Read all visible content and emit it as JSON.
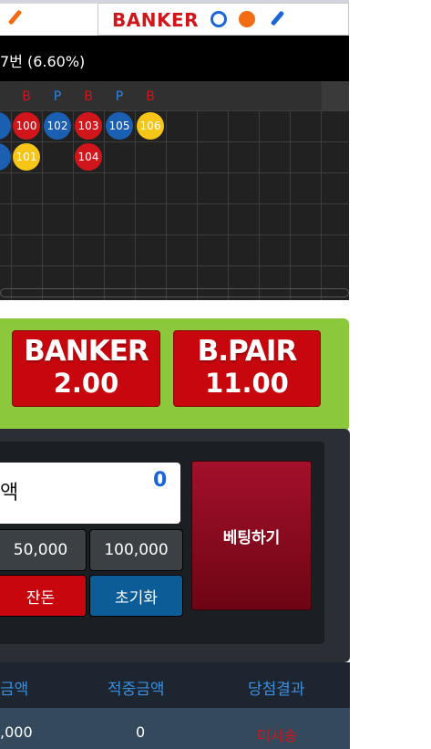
{
  "top": {
    "banker_title": "BANKER",
    "icons": [
      "pencil-icon",
      "ring-icon",
      "dot-icon",
      "pencil-icon"
    ],
    "colors": {
      "banker_red": "#d0161b",
      "player_blue": "#1b66d6",
      "orange": "#f36b12"
    }
  },
  "stats": {
    "text": "7번 (6.60%)"
  },
  "board": {
    "header_labels": [
      "B",
      "P",
      "B",
      "P",
      "B"
    ],
    "beads_row1": [
      {
        "label": "",
        "color": "#1b5fb3"
      },
      {
        "label": "100",
        "color": "#d0161b"
      },
      {
        "label": "102",
        "color": "#1b5fb3"
      },
      {
        "label": "103",
        "color": "#d0161b"
      },
      {
        "label": "105",
        "color": "#1b5fb3"
      },
      {
        "label": "106",
        "color": "#f5c518"
      }
    ],
    "beads_row2": [
      {
        "label": "",
        "color": "#1b5fb3"
      },
      {
        "label": "101",
        "color": "#f5c518"
      },
      {
        "label": "104",
        "color": "#d0161b"
      }
    ]
  },
  "odds": [
    {
      "name": "BANKER",
      "value": "2.00"
    },
    {
      "name": "B.PAIR",
      "value": "11.00"
    }
  ],
  "control": {
    "amount_label": "액",
    "amount_value": "0",
    "chip_50000": "50,000",
    "chip_100000": "100,000",
    "balance_button": "잔돈",
    "reset_button": "초기화",
    "bet_button": "베팅하기"
  },
  "table": {
    "headers": [
      "금액",
      "적중금액",
      "당첨결과"
    ],
    "row": [
      ",000",
      "0",
      "미시송"
    ]
  }
}
